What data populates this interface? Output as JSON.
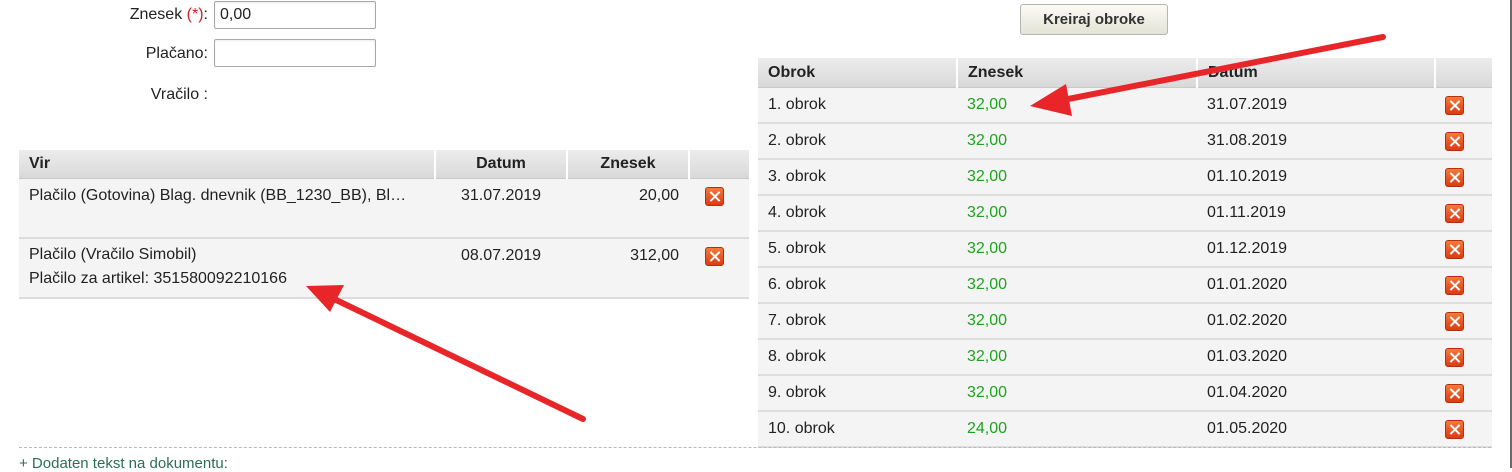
{
  "form": {
    "amount_label": "Znesek",
    "required_marker": "(*)",
    "amount_colon": ":",
    "amount_value": "0,00",
    "paid_label": "Plačano:",
    "paid_value": "",
    "change_label": "Vračilo :"
  },
  "create_button_label": "Kreiraj obroke",
  "payments": {
    "headers": {
      "source": "Vir",
      "date": "Datum",
      "amount": "Znesek"
    },
    "rows": [
      {
        "source": "Plačilo (Gotovina) Blag. dnevnik (BB_1230_BB), Bl…",
        "source2": "",
        "date": "31.07.2019",
        "amount": "20,00"
      },
      {
        "source": "Plačilo (Vračilo Simobil)",
        "source2": "Plačilo za artikel: 351580092210166",
        "date": "08.07.2019",
        "amount": "312,00"
      }
    ]
  },
  "installments": {
    "headers": {
      "installment": "Obrok",
      "amount": "Znesek",
      "date": "Datum"
    },
    "rows": [
      {
        "installment": "1. obrok",
        "amount": "32,00",
        "date": "31.07.2019"
      },
      {
        "installment": "2. obrok",
        "amount": "32,00",
        "date": "31.08.2019"
      },
      {
        "installment": "3. obrok",
        "amount": "32,00",
        "date": "01.10.2019"
      },
      {
        "installment": "4. obrok",
        "amount": "32,00",
        "date": "01.11.2019"
      },
      {
        "installment": "5. obrok",
        "amount": "32,00",
        "date": "01.12.2019"
      },
      {
        "installment": "6. obrok",
        "amount": "32,00",
        "date": "01.01.2020"
      },
      {
        "installment": "7. obrok",
        "amount": "32,00",
        "date": "01.02.2020"
      },
      {
        "installment": "8. obrok",
        "amount": "32,00",
        "date": "01.03.2020"
      },
      {
        "installment": "9. obrok",
        "amount": "32,00",
        "date": "01.04.2020"
      },
      {
        "installment": "10. obrok",
        "amount": "24,00",
        "date": "01.05.2020"
      }
    ]
  },
  "additional_text_link": "+ Dodaten tekst na dokumentu:",
  "colors": {
    "amount_green": "#1ea31e",
    "arrow_red": "#e8262a",
    "delete_orange": "#e8501f"
  },
  "icons": {
    "delete": "delete-x-icon",
    "annotation": "red-arrow"
  }
}
